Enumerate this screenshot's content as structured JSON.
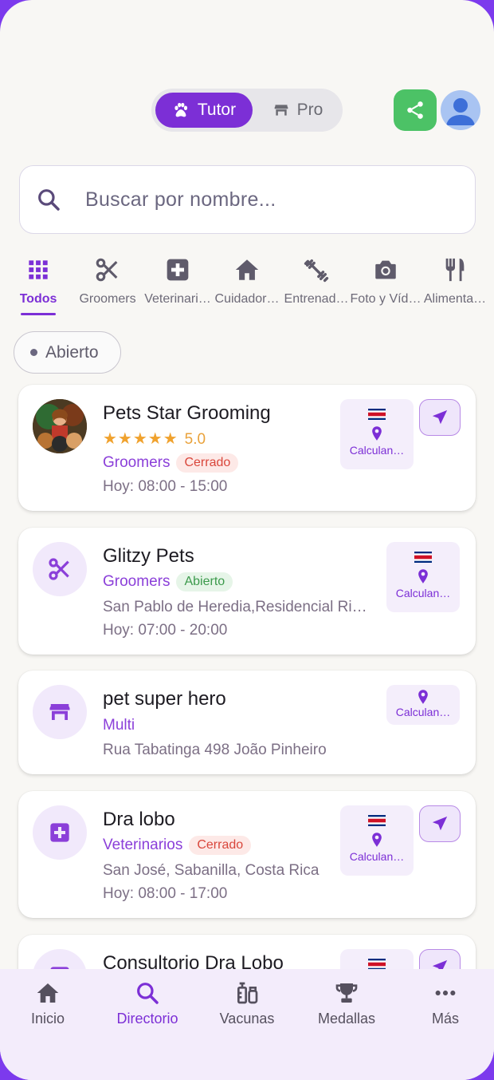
{
  "role_toggle": {
    "tutor_label": "Tutor",
    "pro_label": "Pro",
    "selected": "Tutor"
  },
  "search": {
    "placeholder": "Buscar por nombre..."
  },
  "categories": [
    {
      "label": "Todos",
      "icon": "grid-icon",
      "active": true
    },
    {
      "label": "Groomers",
      "icon": "scissors-icon"
    },
    {
      "label": "Veterinari…",
      "icon": "medical-cross-icon"
    },
    {
      "label": "Cuidador…",
      "icon": "house-icon"
    },
    {
      "label": "Entrenad…",
      "icon": "dumbbell-icon"
    },
    {
      "label": "Foto y Víd…",
      "icon": "camera-icon"
    },
    {
      "label": "Alimenta…",
      "icon": "fork-knife-icon"
    }
  ],
  "filter_chip": {
    "label": "Abierto"
  },
  "listings": [
    {
      "name": "Pets Star Grooming",
      "stars": "★★★★★",
      "rating": "5.0",
      "category": "Groomers",
      "status": "Cerrado",
      "hours": "Hoy: 08:00 - 15:00",
      "distance": "Calculan…"
    },
    {
      "name": "Glitzy Pets",
      "category": "Groomers",
      "status": "Abierto",
      "address": "San Pablo de Heredia,Residencial Ri…",
      "hours": "Hoy: 07:00 - 20:00",
      "distance": "Calculan…"
    },
    {
      "name": "pet super hero",
      "category": "Multi",
      "address": "Rua Tabatinga 498 João Pinheiro",
      "distance": "Calculan…"
    },
    {
      "name": "Dra lobo",
      "category": "Veterinarios",
      "status": "Cerrado",
      "address": "San José, Sabanilla, Costa Rica",
      "hours": "Hoy: 08:00 - 17:00",
      "distance": "Calculan…"
    },
    {
      "name": "Consultorio Dra Lobo"
    }
  ],
  "bottom_nav": [
    {
      "label": "Inicio",
      "icon": "home-icon"
    },
    {
      "label": "Directorio",
      "icon": "search-icon",
      "active": true
    },
    {
      "label": "Vacunas",
      "icon": "vaccine-icon"
    },
    {
      "label": "Medallas",
      "icon": "trophy-icon"
    },
    {
      "label": "Más",
      "icon": "more-icon"
    }
  ],
  "colors": {
    "accent": "#7c2fd6",
    "share": "#4cc266",
    "closed": "#d9463b",
    "open": "#3c9a4c"
  }
}
